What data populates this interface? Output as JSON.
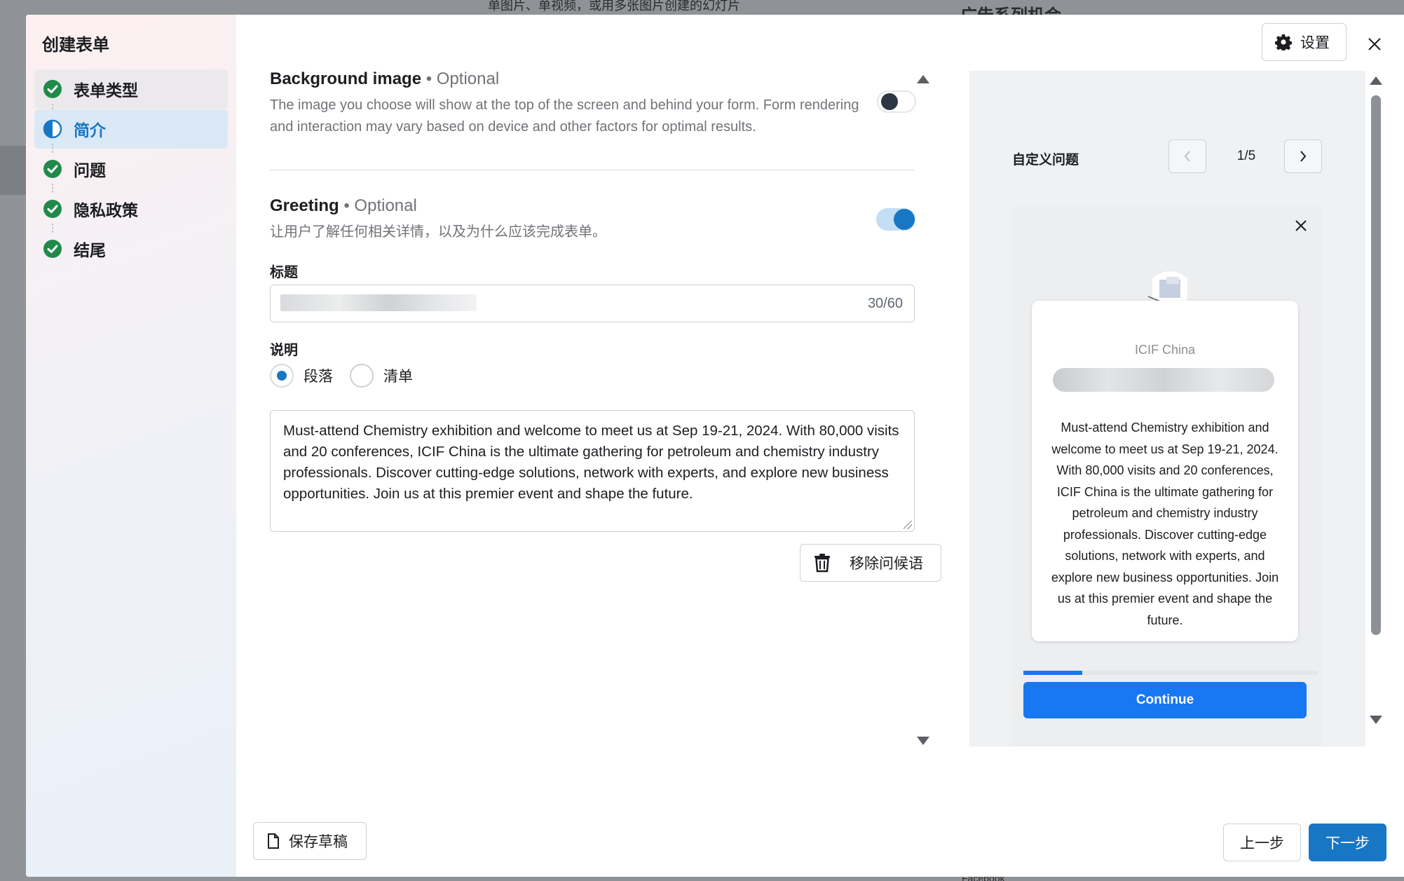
{
  "backdrop": {
    "top_text": "单图片、单视频，或用多张图片创建的幻灯片",
    "top_right_text": "广告系列机会",
    "bottom_text": "Facebook"
  },
  "sidebar": {
    "title": "创建表单",
    "steps": [
      {
        "label": "表单类型",
        "state": "done",
        "icon": "check-circle-icon"
      },
      {
        "label": "简介",
        "state": "active",
        "icon": "half-circle-icon"
      },
      {
        "label": "问题",
        "state": "done",
        "icon": "check-circle-icon"
      },
      {
        "label": "隐私政策",
        "state": "done",
        "icon": "check-circle-icon"
      },
      {
        "label": "结尾",
        "state": "done",
        "icon": "check-circle-icon"
      }
    ]
  },
  "header": {
    "settings_label": "设置",
    "settings_icon": "gear-icon",
    "close_icon": "close-icon"
  },
  "form": {
    "background_image": {
      "title": "Background image",
      "optional": "• Optional",
      "description": "The image you choose will show at the top of the screen and behind your form. Form rendering and interaction may vary based on device and other factors for optimal results.",
      "enabled": false
    },
    "greeting": {
      "title": "Greeting",
      "optional": "• Optional",
      "description": "让用户了解任何相关详情，以及为什么应该完成表单。",
      "enabled": true
    },
    "headline_label": "标题",
    "headline_counter": "30/60",
    "description_label": "说明",
    "format_options": [
      {
        "label": "段落",
        "checked": true
      },
      {
        "label": "清单",
        "checked": false
      }
    ],
    "description_text": "Must-attend Chemistry exhibition and welcome to meet us at Sep 19-21, 2024. With 80,000 visits and 20 conferences, ICIF China is the ultimate gathering for petroleum and chemistry industry professionals. Discover cutting-edge solutions, network with experts, and explore new business opportunities. Join us at this premier event and shape the future.",
    "remove_greeting_label": "移除问候语",
    "remove_icon": "trash-icon"
  },
  "preview": {
    "title": "自定义问题",
    "page_indicator": "1/5",
    "prev_icon": "chevron-left-icon",
    "next_icon": "chevron-right-icon",
    "card": {
      "page_name": "ICIF China",
      "description": "Must-attend Chemistry exhibition and welcome to meet us at Sep 19-21, 2024. With 80,000 visits and 20 conferences, ICIF China is the ultimate gathering for petroleum and chemistry industry professionals. Discover cutting-edge solutions, network with experts, and explore new business opportunities. Join us at this premier event and shape the future."
    },
    "progress_fraction": 0.2,
    "continue_label": "Continue"
  },
  "footer": {
    "save_draft_label": "保存草稿",
    "save_icon": "document-icon",
    "prev_label": "上一步",
    "next_label": "下一步"
  },
  "colors": {
    "accent": "#1877c5",
    "preview_button": "#1877f2",
    "active_step_bg": "#dbe8f6",
    "check_green": "#218a4a"
  }
}
